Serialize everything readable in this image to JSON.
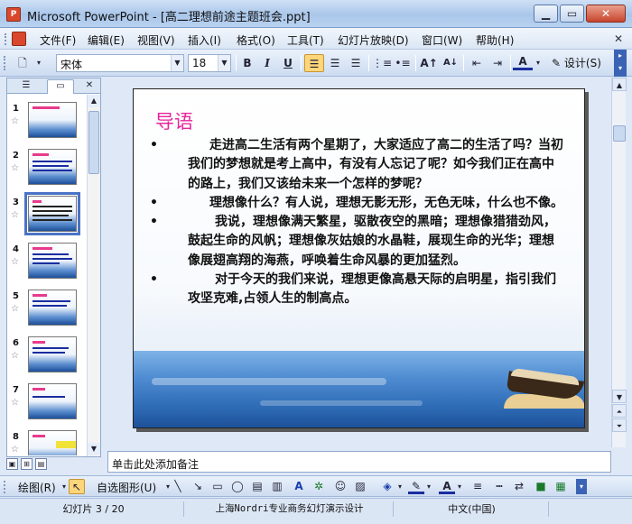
{
  "window": {
    "title": "Microsoft PowerPoint - [高二理想前途主题班会.ppt]",
    "app_icon_letter": "P"
  },
  "menu": {
    "items": [
      "文件(F)",
      "编辑(E)",
      "视图(V)",
      "插入(I)",
      "格式(O)",
      "工具(T)",
      "幻灯片放映(D)",
      "窗口(W)",
      "帮助(H)"
    ]
  },
  "toolbar": {
    "font_name": "宋体",
    "font_size": "18",
    "bold": "B",
    "italic": "I",
    "underline": "U",
    "design_label": "设计(S)"
  },
  "panel": {
    "slide_numbers": [
      "1",
      "2",
      "3",
      "4",
      "5",
      "6",
      "7",
      "8"
    ],
    "selected_slide": 3
  },
  "slide": {
    "title": "导语",
    "bullets": [
      "走进高二生活有两个星期了，大家适应了高二的生活了吗？当初我们的梦想就是考上高中，有没有人忘记了呢？如今我们正在高中的路上，我们又该给未来一个怎样的梦呢？",
      "理想像什么？有人说，理想无影无形，无色无味，什么也不像。",
      "我说，理想像满天繁星，驱散夜空的黑暗；理想像猎猎劲风，鼓起生命的风帆；理想像灰姑娘的水晶鞋，展现生命的光华；理想像展翅高翔的海燕，呼唤着生命风暴的更加猛烈。",
      "对于今天的我们来说，理想更像高悬天际的启明星，指引我们攻坚克难,占领人生的制高点。"
    ],
    "bullet_symbol": "•"
  },
  "notes": {
    "placeholder": "单击此处添加备注"
  },
  "drawbar": {
    "draw_label": "绘图(R)",
    "autoshapes_label": "自选图形(U)"
  },
  "status": {
    "slide_info": "幻灯片 3 / 20",
    "design_name": "上海Nordri专业商务幻灯演示设计",
    "language": "中文(中国)"
  },
  "colors": {
    "title_pink": "#e6269a",
    "accent_blue": "#4a73c6"
  }
}
